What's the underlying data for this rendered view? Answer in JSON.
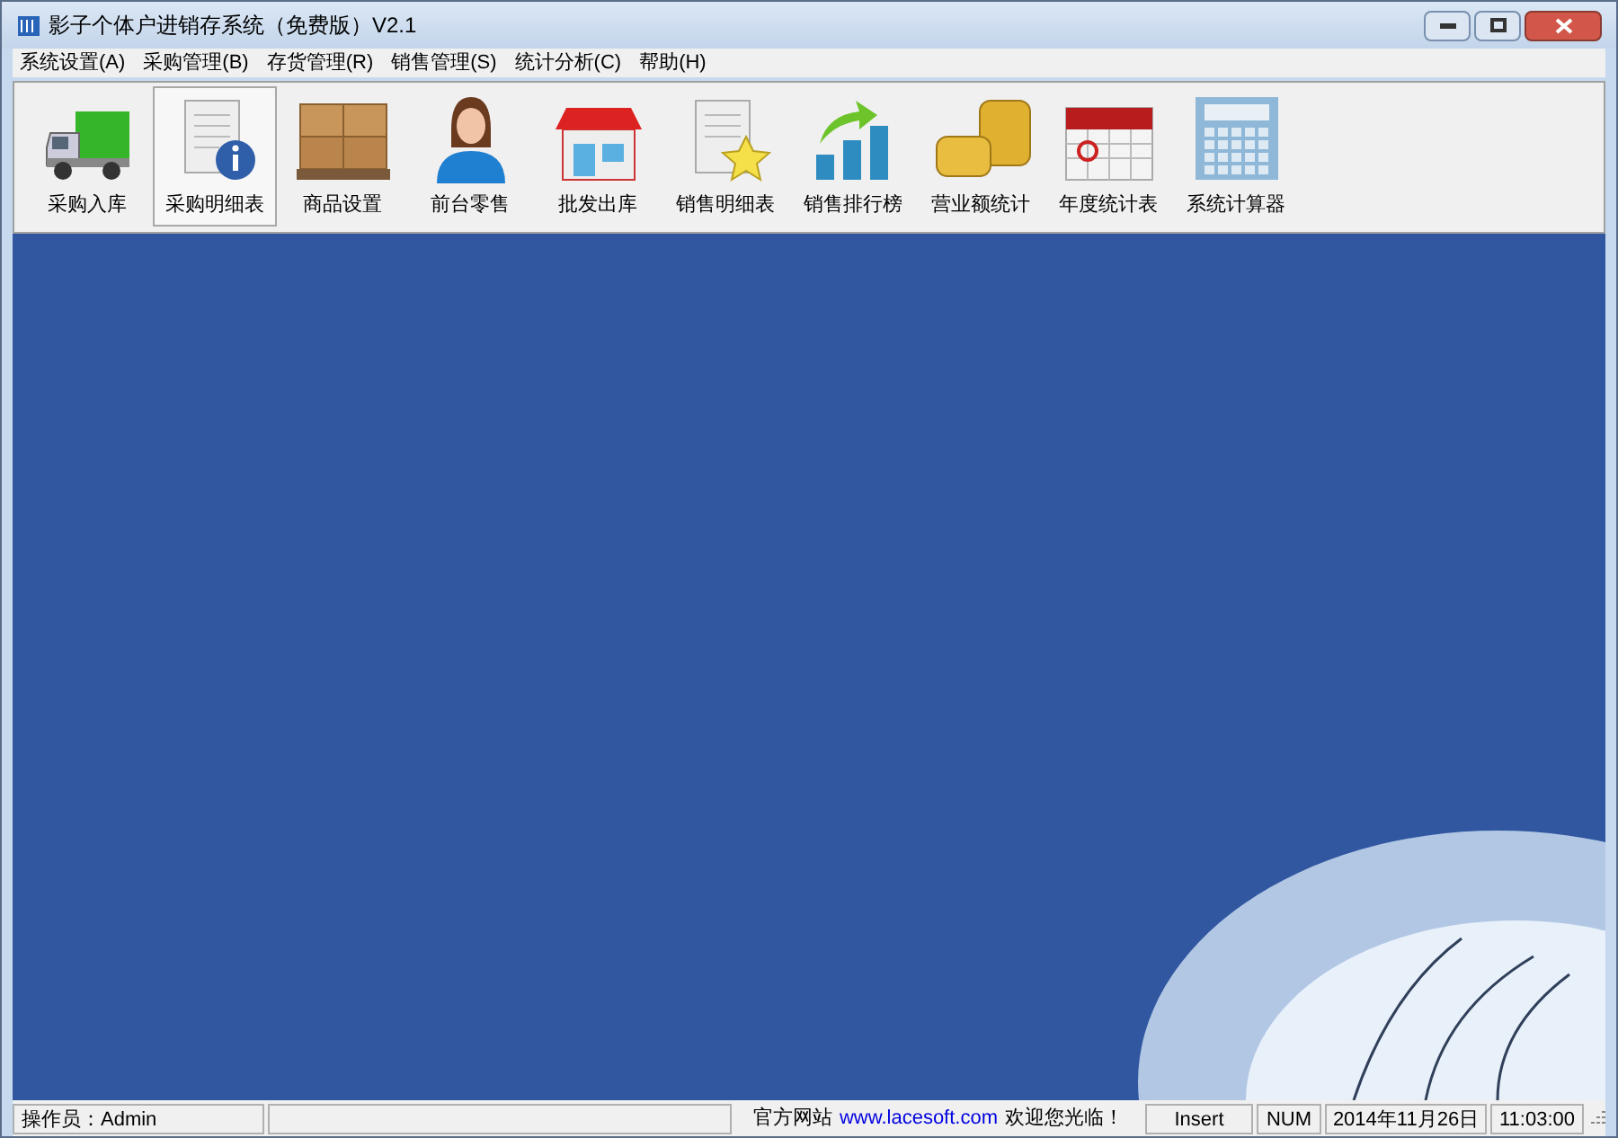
{
  "window": {
    "title": "影子个体户进销存系统（免费版）V2.1"
  },
  "menu": [
    {
      "label": "系统设置(A)"
    },
    {
      "label": "采购管理(B)"
    },
    {
      "label": "存货管理(R)"
    },
    {
      "label": "销售管理(S)"
    },
    {
      "label": "统计分析(C)"
    },
    {
      "label": "帮助(H)"
    }
  ],
  "toolbar": [
    {
      "label": "采购入库",
      "selected": false
    },
    {
      "label": "采购明细表",
      "selected": true
    },
    {
      "label": "商品设置",
      "selected": false
    },
    {
      "label": "前台零售",
      "selected": false
    },
    {
      "label": "批发出库",
      "selected": false
    },
    {
      "label": "销售明细表",
      "selected": false
    },
    {
      "label": "销售排行榜",
      "selected": false
    },
    {
      "label": "营业额统计",
      "selected": false
    },
    {
      "label": "年度统计表",
      "selected": false
    },
    {
      "label": "系统计算器",
      "selected": false
    }
  ],
  "status_bar": {
    "operator": "操作员：Admin",
    "site_label": "官方网站",
    "site_link": "www.lacesoft.com",
    "welcome": "欢迎您光临！",
    "insert": "Insert",
    "num": "NUM",
    "date": "2014年11月26日",
    "time": "11:03:00"
  }
}
